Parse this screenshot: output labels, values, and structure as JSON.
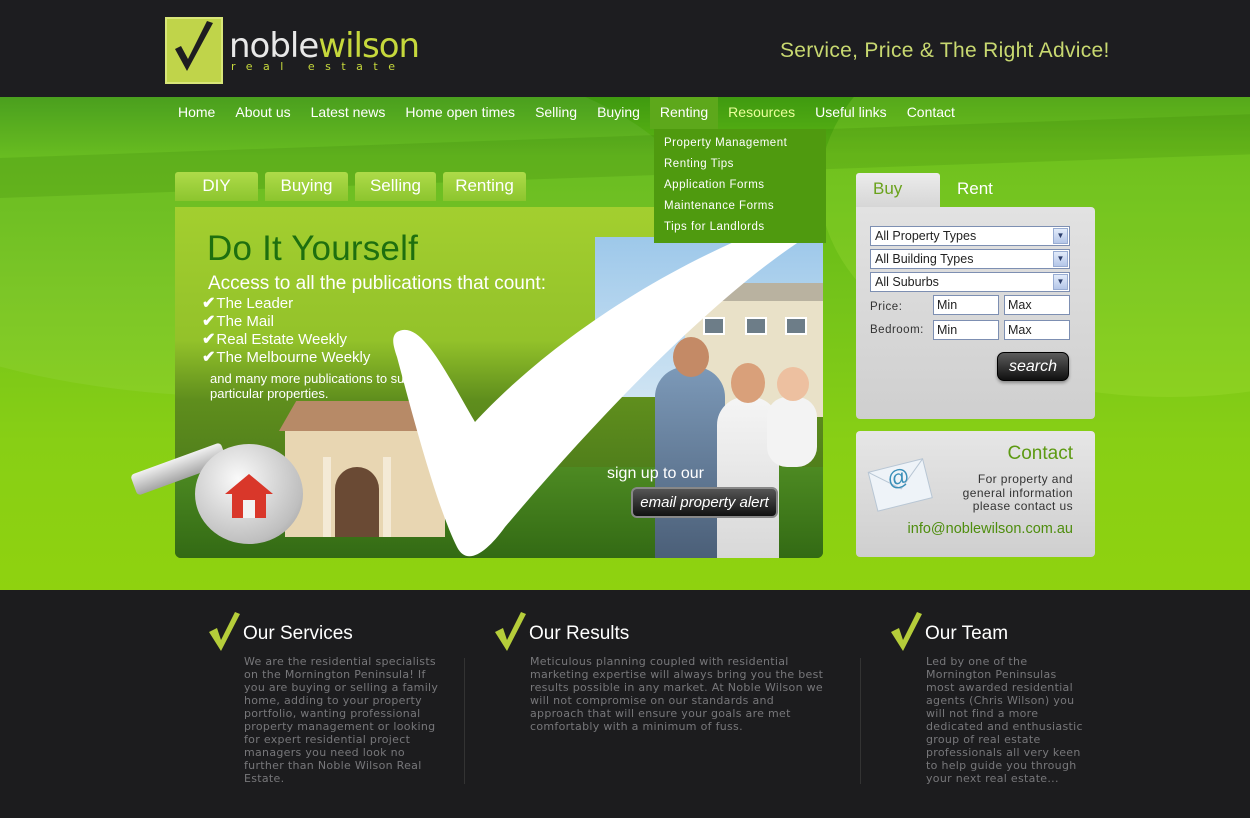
{
  "header": {
    "logo_name_part1": "noble",
    "logo_name_part2": "wilson",
    "logo_subtitle": "real estate",
    "tagline": "Service, Price & The Right Advice!"
  },
  "nav": {
    "items": [
      {
        "label": "Home"
      },
      {
        "label": "About us"
      },
      {
        "label": "Latest news"
      },
      {
        "label": "Home open times"
      },
      {
        "label": "Selling"
      },
      {
        "label": "Buying"
      },
      {
        "label": "Renting",
        "active": true
      },
      {
        "label": "Resources"
      },
      {
        "label": "Useful links"
      },
      {
        "label": "Contact"
      }
    ],
    "dropdown": [
      {
        "label": "Property Management"
      },
      {
        "label": "Renting Tips"
      },
      {
        "label": "Application Forms"
      },
      {
        "label": "Maintenance Forms"
      },
      {
        "label": "Tips for Landlords"
      }
    ]
  },
  "feature_tabs": [
    {
      "label": "DIY"
    },
    {
      "label": "Buying"
    },
    {
      "label": "Selling"
    },
    {
      "label": "Renting"
    }
  ],
  "feature": {
    "title": "Do It Yourself",
    "subtitle": "Access to all the publications that count:",
    "publications": [
      {
        "label": "The Leader"
      },
      {
        "label": "The Mail"
      },
      {
        "label": "Real Estate Weekly"
      },
      {
        "label": "The Melbourne Weekly"
      }
    ],
    "note": "and many more  publications to suit particular properties.",
    "signup_text": "sign up to our",
    "alert_button": "email property alert"
  },
  "search": {
    "tabs": [
      {
        "label": "Buy",
        "active": true
      },
      {
        "label": "Rent"
      }
    ],
    "property_type": "All Property Types",
    "building_type": "All Building Types",
    "suburb": "All Suburbs",
    "price_label": "Price:",
    "bedroom_label": "Bedroom:",
    "min_placeholder": "Min",
    "max_placeholder": "Max",
    "button": "search"
  },
  "contact": {
    "title": "Contact",
    "text": "For property and general information please contact us",
    "email": "info@noblewilson.com.au"
  },
  "footer": {
    "services": {
      "title": "Our Services",
      "text": "We are the residential specialists on the Mornington Peninsula! If you are buying or selling a family home, adding to your property portfolio, wanting professional property management or looking for expert residential project managers you need look no further than Noble Wilson Real Estate."
    },
    "results": {
      "title": "Our Results",
      "text": "Meticulous planning coupled with residential marketing expertise will always bring you the best results possible in any market. At Noble Wilson we will not compromise on our standards and approach that will ensure your goals are met comfortably with a minimum of fuss."
    },
    "team": {
      "title": "Our Team",
      "text": "Led by one of the Mornington Peninsulas most awarded residential agents (Chris Wilson) you will not find a more dedicated and enthusiastic group of real estate professionals all very keen to help guide you through your next real estate..."
    }
  },
  "colors": {
    "brand_green": "#c6d83c",
    "hero_green": "#74c31a",
    "dark_bg": "#1c1c1e",
    "contact_green": "#4e8d0e"
  }
}
